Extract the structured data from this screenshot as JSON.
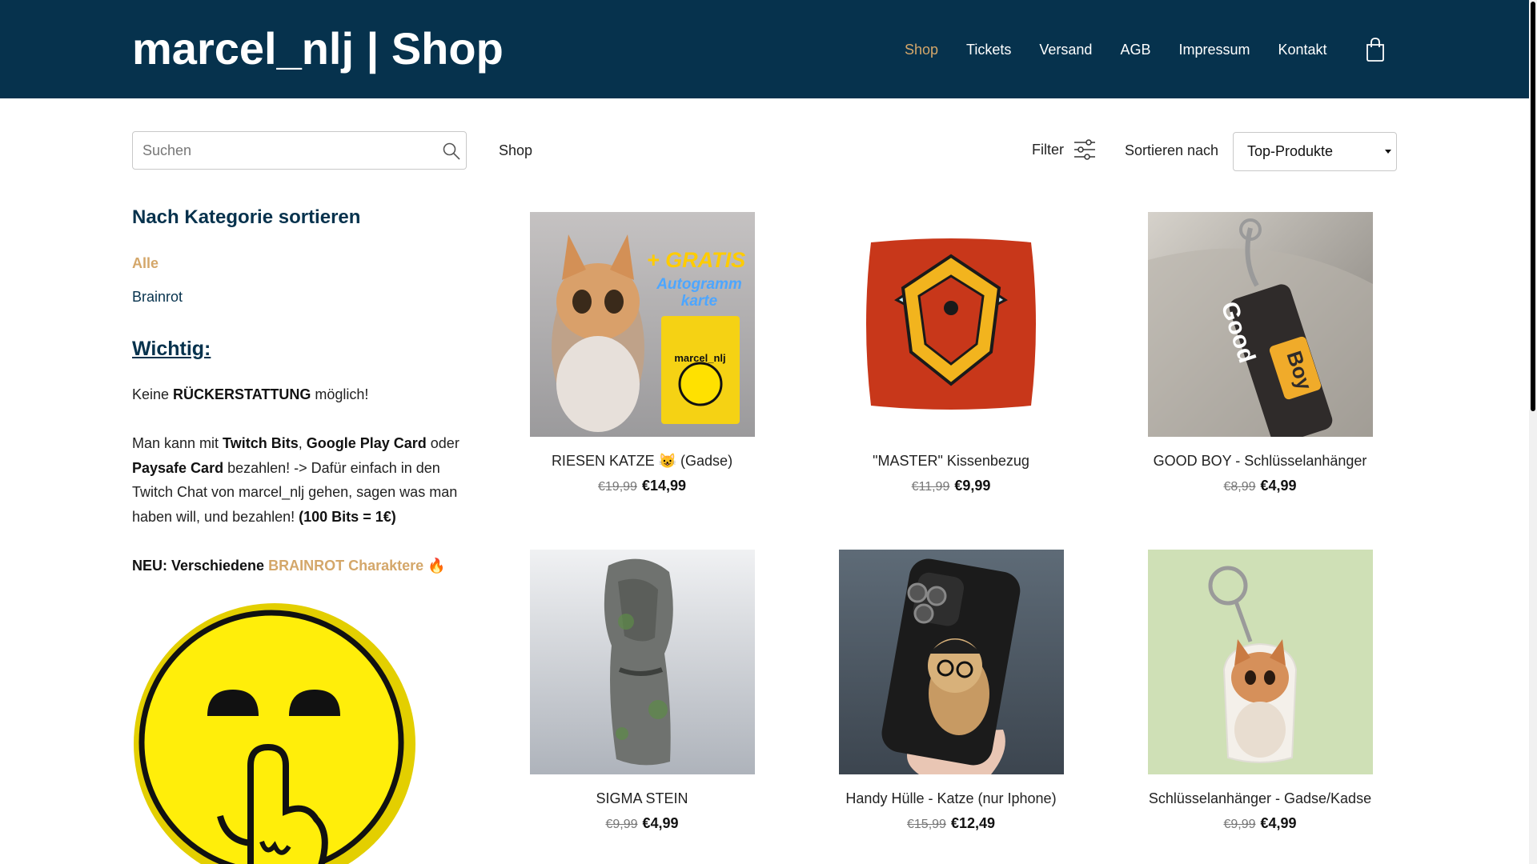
{
  "header": {
    "title": "marcel_nlj | Shop",
    "nav": [
      "Shop",
      "Tickets",
      "Versand",
      "AGB",
      "Impressum",
      "Kontakt"
    ],
    "active_nav": "Shop",
    "cart_icon": "shopping-bag-icon"
  },
  "toolbar": {
    "search_placeholder": "Suchen",
    "search_value": "",
    "breadcrumb": "Shop",
    "filter_label": "Filter",
    "sort_label": "Sortieren nach",
    "sort_value": "Top-Produkte"
  },
  "sidebar": {
    "heading": "Nach Kategorie sortieren",
    "categories": [
      "Alle",
      "Brainrot"
    ],
    "active_category": "Alle",
    "notice_heading": "Wichtig:",
    "p1": {
      "a": "Keine ",
      "b": "RÜCKERSTATTUNG",
      "c": " möglich!"
    },
    "p2": {
      "a": "Man kann mit ",
      "b": "Twitch Bits",
      "c": ", ",
      "d": "Google Play Card",
      "e": " oder ",
      "f": "Paysafe Card",
      "g": " bezahlen! -> Dafür einfach in den Twitch Chat von marcel_nlj gehen, sagen was man haben will, und bezahlen!  ",
      "h": "(100 Bits = 1€)"
    },
    "p3": {
      "a": "NEU:  Verschiedene ",
      "b": "BRAINROT Charaktere",
      "c": " 🔥"
    }
  },
  "colors": {
    "header_bg": "#06324d",
    "accent_gold": "#d4a76a",
    "link_navy": "#06324d"
  },
  "products": [
    {
      "name": "RIESEN KATZE 😺 (Gadse)",
      "old_price": "€19,99",
      "price": "€14,99",
      "image_text": {
        "gratis": "+ GRATIS",
        "card": "Autogramm karte",
        "brand": "marcel_nlj"
      }
    },
    {
      "name": "\"MASTER\" Kissenbezug",
      "old_price": "€11,99",
      "price": "€9,99"
    },
    {
      "name": "GOOD BOY - Schlüsselanhänger",
      "old_price": "€8,99",
      "price": "€4,99",
      "image_text": {
        "good": "Good",
        "boy": "Boy"
      }
    },
    {
      "name": "SIGMA STEIN",
      "old_price": "€9,99",
      "price": "€4,99"
    },
    {
      "name": "Handy Hülle - Katze (nur Iphone)",
      "old_price": "€15,99",
      "price": "€12,49"
    },
    {
      "name": "Schlüsselanhänger - Gadse/Kadse",
      "old_price": "€9,99",
      "price": "€4,99"
    }
  ]
}
